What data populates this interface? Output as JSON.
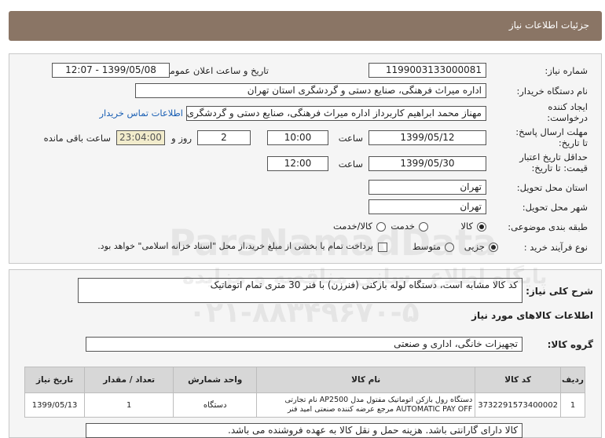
{
  "header": {
    "title": "جزئیات اطلاعات نیاز"
  },
  "form": {
    "need_number_label": "شماره نیاز:",
    "need_number": "1199003133000081",
    "announce_label": "تاریخ و ساعت اعلان عمومی:",
    "announce_value": "1399/05/08 - 12:07",
    "buyer_org_label": "نام دستگاه خریدار:",
    "buyer_org": "اداره میراث فرهنگی، صنایع دستی و گردشگری استان تهران",
    "creator_label_1": "ایجاد کننده",
    "creator_label_2": "درخواست:",
    "creator": "مهناز محمد ابراهیم کاربرداز اداره میراث فرهنگی، صنایع دستی و گردشگری استا",
    "contact_link": "اطلاعات تماس خریدار",
    "deadline_label_1": "مهلت ارسال پاسخ:",
    "deadline_label_2": "تا تاریخ:",
    "deadline_date": "1399/05/12",
    "time_label": "ساعت",
    "deadline_time": "10:00",
    "days_value": "2",
    "days_label": "روز و",
    "remaining_time": "23:04:00",
    "remaining_label": "ساعت باقی مانده",
    "validity_label_1": "حداقل تاریخ اعتبار",
    "validity_label_2": "قیمت: تا تاریخ:",
    "validity_date": "1399/05/30",
    "validity_time_label": "ساعت",
    "validity_time": "12:00",
    "province_label": "استان محل تحویل:",
    "province": "تهران",
    "city_label": "شهر محل تحویل:",
    "city": "تهران",
    "category_label": "طبقه بندی موضوعی:",
    "category_options": [
      "کالا",
      "خدمت",
      "کالا/خدمت"
    ],
    "category_selected": "کالا",
    "process_label": "نوع فرآیند خرید :",
    "process_options": [
      "جزیی",
      "متوسط"
    ],
    "process_selected": "جزیی",
    "payment_note": "پرداخت تمام یا بخشی از مبلغ خرید،از محل \"اسناد خزانه اسلامی\" خواهد بود."
  },
  "details": {
    "general_desc_label": "شرح کلی نیاز:",
    "general_desc": "کد کالا مشابه است، دستگاه لوله بازکنی (فنرزن) با فنر 30 متری تمام اتوماتیک",
    "goods_info_title": "اطلاعات کالاهای مورد نیاز",
    "goods_group_label": "گروه کالا:",
    "goods_group": "تجهیزات خانگی، اداری و صنعتی"
  },
  "table": {
    "headers": [
      "ردیف",
      "کد کالا",
      "نام کالا",
      "واحد شمارش",
      "تعداد / مقدار",
      "تاریخ نیاز"
    ],
    "rows": [
      {
        "row": "1",
        "code": "3732291573400002",
        "name": "دستگاه رول بازکن اتوماتیک مفتول مدل AP2500 نام تجارتی AUTOMATIC PAY OFF مرجع عرضه کننده صنعتی امید فنر",
        "unit": "دستگاه",
        "qty": "1",
        "date": "1399/05/13"
      }
    ]
  },
  "footer_note": "کالا دارای گارانتی باشد. هزینه حمل و نقل کالا به عهده فروشنده می باشد.",
  "watermark": {
    "brand": "ParsNamadData",
    "line1": "پایگاه اطلاع رسانی مناقصه و مزایده",
    "phone": "۰۲۱-۸۸۳۴۹۶۷۰-۵"
  }
}
